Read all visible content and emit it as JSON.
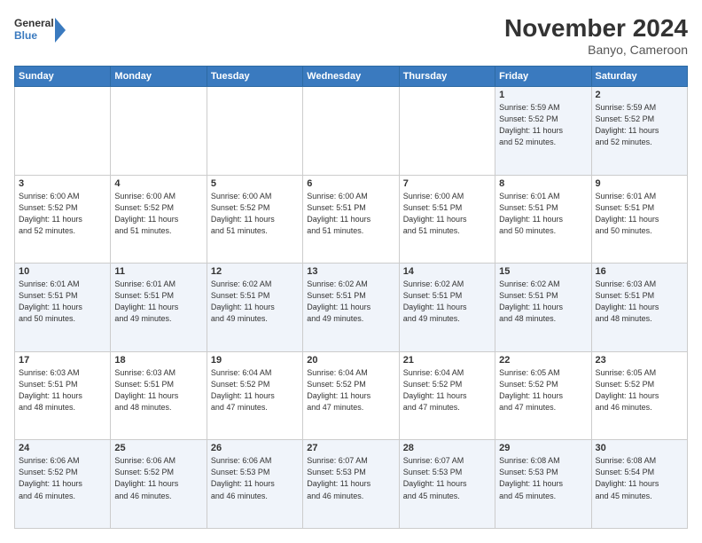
{
  "header": {
    "logo_line1": "General",
    "logo_line2": "Blue",
    "month_year": "November 2024",
    "location": "Banyo, Cameroon"
  },
  "weekdays": [
    "Sunday",
    "Monday",
    "Tuesday",
    "Wednesday",
    "Thursday",
    "Friday",
    "Saturday"
  ],
  "weeks": [
    [
      {
        "day": "",
        "info": ""
      },
      {
        "day": "",
        "info": ""
      },
      {
        "day": "",
        "info": ""
      },
      {
        "day": "",
        "info": ""
      },
      {
        "day": "",
        "info": ""
      },
      {
        "day": "1",
        "info": "Sunrise: 5:59 AM\nSunset: 5:52 PM\nDaylight: 11 hours\nand 52 minutes."
      },
      {
        "day": "2",
        "info": "Sunrise: 5:59 AM\nSunset: 5:52 PM\nDaylight: 11 hours\nand 52 minutes."
      }
    ],
    [
      {
        "day": "3",
        "info": "Sunrise: 6:00 AM\nSunset: 5:52 PM\nDaylight: 11 hours\nand 52 minutes."
      },
      {
        "day": "4",
        "info": "Sunrise: 6:00 AM\nSunset: 5:52 PM\nDaylight: 11 hours\nand 51 minutes."
      },
      {
        "day": "5",
        "info": "Sunrise: 6:00 AM\nSunset: 5:52 PM\nDaylight: 11 hours\nand 51 minutes."
      },
      {
        "day": "6",
        "info": "Sunrise: 6:00 AM\nSunset: 5:51 PM\nDaylight: 11 hours\nand 51 minutes."
      },
      {
        "day": "7",
        "info": "Sunrise: 6:00 AM\nSunset: 5:51 PM\nDaylight: 11 hours\nand 51 minutes."
      },
      {
        "day": "8",
        "info": "Sunrise: 6:01 AM\nSunset: 5:51 PM\nDaylight: 11 hours\nand 50 minutes."
      },
      {
        "day": "9",
        "info": "Sunrise: 6:01 AM\nSunset: 5:51 PM\nDaylight: 11 hours\nand 50 minutes."
      }
    ],
    [
      {
        "day": "10",
        "info": "Sunrise: 6:01 AM\nSunset: 5:51 PM\nDaylight: 11 hours\nand 50 minutes."
      },
      {
        "day": "11",
        "info": "Sunrise: 6:01 AM\nSunset: 5:51 PM\nDaylight: 11 hours\nand 49 minutes."
      },
      {
        "day": "12",
        "info": "Sunrise: 6:02 AM\nSunset: 5:51 PM\nDaylight: 11 hours\nand 49 minutes."
      },
      {
        "day": "13",
        "info": "Sunrise: 6:02 AM\nSunset: 5:51 PM\nDaylight: 11 hours\nand 49 minutes."
      },
      {
        "day": "14",
        "info": "Sunrise: 6:02 AM\nSunset: 5:51 PM\nDaylight: 11 hours\nand 49 minutes."
      },
      {
        "day": "15",
        "info": "Sunrise: 6:02 AM\nSunset: 5:51 PM\nDaylight: 11 hours\nand 48 minutes."
      },
      {
        "day": "16",
        "info": "Sunrise: 6:03 AM\nSunset: 5:51 PM\nDaylight: 11 hours\nand 48 minutes."
      }
    ],
    [
      {
        "day": "17",
        "info": "Sunrise: 6:03 AM\nSunset: 5:51 PM\nDaylight: 11 hours\nand 48 minutes."
      },
      {
        "day": "18",
        "info": "Sunrise: 6:03 AM\nSunset: 5:51 PM\nDaylight: 11 hours\nand 48 minutes."
      },
      {
        "day": "19",
        "info": "Sunrise: 6:04 AM\nSunset: 5:52 PM\nDaylight: 11 hours\nand 47 minutes."
      },
      {
        "day": "20",
        "info": "Sunrise: 6:04 AM\nSunset: 5:52 PM\nDaylight: 11 hours\nand 47 minutes."
      },
      {
        "day": "21",
        "info": "Sunrise: 6:04 AM\nSunset: 5:52 PM\nDaylight: 11 hours\nand 47 minutes."
      },
      {
        "day": "22",
        "info": "Sunrise: 6:05 AM\nSunset: 5:52 PM\nDaylight: 11 hours\nand 47 minutes."
      },
      {
        "day": "23",
        "info": "Sunrise: 6:05 AM\nSunset: 5:52 PM\nDaylight: 11 hours\nand 46 minutes."
      }
    ],
    [
      {
        "day": "24",
        "info": "Sunrise: 6:06 AM\nSunset: 5:52 PM\nDaylight: 11 hours\nand 46 minutes."
      },
      {
        "day": "25",
        "info": "Sunrise: 6:06 AM\nSunset: 5:52 PM\nDaylight: 11 hours\nand 46 minutes."
      },
      {
        "day": "26",
        "info": "Sunrise: 6:06 AM\nSunset: 5:53 PM\nDaylight: 11 hours\nand 46 minutes."
      },
      {
        "day": "27",
        "info": "Sunrise: 6:07 AM\nSunset: 5:53 PM\nDaylight: 11 hours\nand 46 minutes."
      },
      {
        "day": "28",
        "info": "Sunrise: 6:07 AM\nSunset: 5:53 PM\nDaylight: 11 hours\nand 45 minutes."
      },
      {
        "day": "29",
        "info": "Sunrise: 6:08 AM\nSunset: 5:53 PM\nDaylight: 11 hours\nand 45 minutes."
      },
      {
        "day": "30",
        "info": "Sunrise: 6:08 AM\nSunset: 5:54 PM\nDaylight: 11 hours\nand 45 minutes."
      }
    ]
  ]
}
